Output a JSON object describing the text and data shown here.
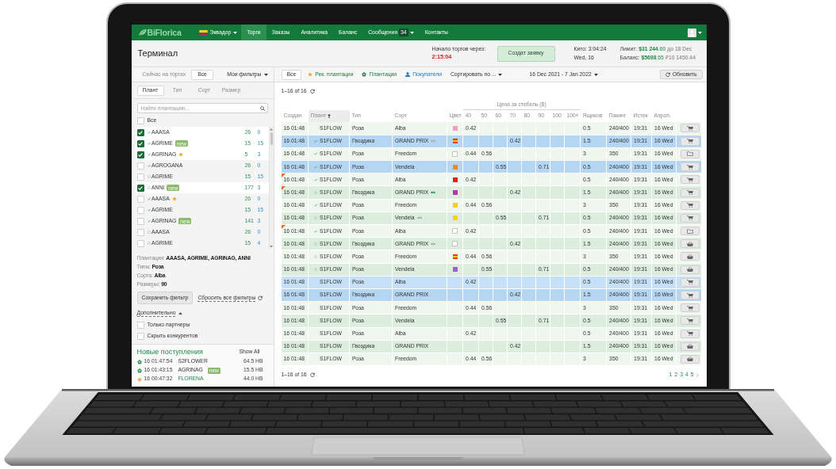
{
  "nav": {
    "logo": "BiFlorica",
    "country": "Эквадор",
    "items": [
      {
        "label": "Торги",
        "selected": true,
        "dropdown": false
      },
      {
        "label": "Заказы",
        "selected": false,
        "dropdown": false
      },
      {
        "label": "Аналитика",
        "selected": false,
        "dropdown": false
      },
      {
        "label": "Баланс",
        "selected": false,
        "dropdown": false
      },
      {
        "label": "Сообщения",
        "selected": false,
        "badge": "34",
        "dropdown": true
      },
      {
        "label": "Контакты",
        "selected": false,
        "dropdown": false
      }
    ]
  },
  "header": {
    "title": "Терминал",
    "countdown": {
      "label": "Начало торгов через:",
      "value": "2:15:04"
    },
    "create_button": "Создат заявку",
    "clock": [
      "Кито: 3:04:24",
      "Wed, 16"
    ],
    "limits": [
      {
        "label": "Лимит:",
        "value": "**$31 244**.60",
        "note": "до 18 Dec"
      },
      {
        "label": "Баланс:",
        "value": "**$5698**.65",
        "note": "₽10 1450.44"
      }
    ]
  },
  "filter_bar": {
    "on_sale_label": "Сейчас на торгах",
    "on_sale_button": "Все",
    "my_filters": "Мои фильтры",
    "all_button": "Все",
    "chips": [
      {
        "kind": "star",
        "label": "Рек. плантации"
      },
      {
        "kind": "flower",
        "label": "Плантации"
      },
      {
        "kind": "person",
        "label": "Покупатели"
      }
    ],
    "sort": "Сортировать по ...",
    "date_range": "16 Dec 2021 - 7 Jan 2022",
    "refresh_button": "Обновить"
  },
  "sidebar": {
    "tabs": [
      {
        "label": "Плант",
        "selected": true
      },
      {
        "label": "Тип",
        "selected": false
      },
      {
        "label": "Сорт",
        "selected": false
      },
      {
        "label": "Размер",
        "selected": false
      }
    ],
    "search": {
      "placeholder": "Найти плантацию..."
    },
    "select_all": {
      "label": "Все",
      "checked": false
    },
    "plantations": [
      {
        "name": "AAASA",
        "checked": true,
        "verified": true,
        "starred": false,
        "first_count": "26",
        "second_count": "0"
      },
      {
        "name": "AGRIME",
        "checked": true,
        "verified": true,
        "badge": "new",
        "starred": false,
        "first_count": "15",
        "second_count": "15"
      },
      {
        "name": "AGRINAG",
        "checked": true,
        "verified": true,
        "starred": true,
        "first_count": "5",
        "second_count": "3"
      },
      {
        "name": "AGROGANA",
        "checked": false,
        "verified": true,
        "starred": false,
        "first_count": "26",
        "second_count": "0"
      },
      {
        "name": "AGRIME",
        "checked": false,
        "verified": false,
        "starred": false,
        "first_count": "15",
        "second_count": "15"
      },
      {
        "name": "ANNI",
        "checked": true,
        "verified": false,
        "badge": "new",
        "starred": false,
        "first_count": "177",
        "second_count": "3"
      },
      {
        "name": "AAASA",
        "checked": false,
        "verified": true,
        "starred": true,
        "first_count": "26",
        "second_count": "0"
      },
      {
        "name": "AGRIME",
        "checked": false,
        "verified": true,
        "starred": false,
        "first_count": "15",
        "second_count": "15"
      },
      {
        "name": "AGRINAG",
        "checked": false,
        "verified": true,
        "badge": "new",
        "starred": false,
        "first_count": "141",
        "second_count": "3"
      },
      {
        "name": "AAASA",
        "checked": false,
        "verified": false,
        "starred": false,
        "first_count": "26",
        "second_count": "0"
      },
      {
        "name": "AGRIME",
        "checked": false,
        "verified": false,
        "starred": false,
        "first_count": "15",
        "second_count": "4"
      }
    ],
    "summary": [
      "Плантации: **AAASA, AGRIME, AGRINAG, ANNI**",
      "Типы: **Роза**",
      "Сорта: **Alba**",
      "Размеры: **90**"
    ],
    "save_button": "Сохранить фильтр",
    "reset_link": "Сбросить все фильтры",
    "more": {
      "label": "Дополнительно",
      "expanded": true,
      "options": [
        {
          "label": "Только партнеры",
          "checked": false
        },
        {
          "label": "Скрыть конкурентов",
          "checked": false
        }
      ]
    },
    "arrivals": {
      "title": "Новые поступления",
      "show_all": "Show All",
      "items": [
        {
          "time": "16 01:47:54",
          "name": "S2FLOWER",
          "starred": false,
          "size": "64.5 HB"
        },
        {
          "time": "16 01:43:15",
          "name": "AGRINAG",
          "badge": "new",
          "starred": false,
          "size": "15.5 HB"
        },
        {
          "time": "16 00:47:32",
          "name": "FLORENA",
          "starred": true,
          "size": "44.0 HB"
        }
      ]
    }
  },
  "table": {
    "count": "1–16 of 16",
    "price_group": "Цена за стебель ($)",
    "lead_columns": [
      {
        "label": "Создан",
        "sorted": false
      },
      {
        "label": "Плант",
        "sorted": true
      },
      {
        "label": "Тип",
        "sorted": false
      },
      {
        "label": "Сорт",
        "sorted": false
      },
      {
        "label": "Цвет",
        "sorted": false
      }
    ],
    "price_columns": [
      "40",
      "50",
      "60",
      "70",
      "80",
      "90",
      "100",
      "100+"
    ],
    "tail_columns": [
      "Ящиков",
      "Пакинг",
      "Истек",
      "Аэроп."
    ],
    "rows": [
      {
        "created": "16 01:48",
        "plant": "S1FLOW",
        "type": "Роза",
        "variety": "Alba",
        "color": "#ee9cc6",
        "prices": {
          "p1": "0.42"
        },
        "boxes": "0.5",
        "packing": "240/400",
        "expires": "19:31",
        "airport": "16 Wed",
        "action": {
          "kind": "cart"
        },
        "flagged": false,
        "selected": false
      },
      {
        "created": "16 01:48",
        "plant_status": {
          "kind": "check"
        },
        "plant": "S1FLOW",
        "type": "Гвоздика",
        "variety": "GRAND PRIX",
        "eye": {
          "color": "#a0a0a0"
        },
        "color": "#e23b2b",
        "stripe": {
          "color": "#f6c41c"
        },
        "prices": {
          "p4": "0.42"
        },
        "boxes": "1.5",
        "packing": "240/400",
        "expires": "19:31",
        "airport": "16 Wed",
        "action": {
          "kind": "cart"
        },
        "flagged": false,
        "selected": true
      },
      {
        "created": "16 01:48",
        "plant_status": {
          "kind": "check"
        },
        "plant": "S1FLOW",
        "type": "Роза",
        "variety": "Freedom",
        "color": "#ffffff",
        "prices": {
          "p1": "0.44",
          "p2": "0.56"
        },
        "boxes": "3",
        "packing": "350",
        "expires": "19:31",
        "airport": "16 Wed",
        "action": {
          "kind": "folder"
        },
        "flagged": false,
        "selected": false
      },
      {
        "created": "16 01:48",
        "plant_status": {
          "kind": "check"
        },
        "plant": "S1FLOW",
        "type": "Роза",
        "variety": "Vendela",
        "color": "#f0891c",
        "prices": {
          "p3": "0.55",
          "p6": "0.71"
        },
        "boxes": "0.5",
        "packing": "240/400",
        "expires": "19:31",
        "airport": "16 Wed",
        "action": {
          "kind": "cart"
        },
        "flagged": false,
        "selected": true
      },
      {
        "created": "16 01:48",
        "plant_status": {
          "kind": "check"
        },
        "plant": "S1FLOW",
        "type": "Роза",
        "variety": "Alba",
        "color": "#e22020",
        "prices": {
          "p1": "0.42"
        },
        "boxes": "0.5",
        "packing": "240/400",
        "expires": "19:31",
        "airport": "16 Wed",
        "action": {
          "kind": "cart"
        },
        "flagged": true,
        "selected": false
      },
      {
        "created": "16 01:48",
        "plant_status": {
          "kind": "circle"
        },
        "plant": "S1FLOW",
        "type": "Гвоздика",
        "variety": "GRAND PRIX",
        "eye": {
          "color": "#1f8a4c"
        },
        "color": "#b13a9e",
        "prices": {
          "p4": "0.42"
        },
        "boxes": "1.5",
        "packing": "240/400",
        "expires": "19:31",
        "airport": "16 Wed",
        "action": {
          "kind": "cart"
        },
        "flagged": true,
        "selected": false
      },
      {
        "created": "16 01:48",
        "plant_status": {
          "kind": "check"
        },
        "plant": "S1FLOW",
        "type": "Роза",
        "variety": "Freedom",
        "color": "#f5d20c",
        "prices": {
          "p1": "0.44",
          "p2": "0.56"
        },
        "boxes": "3",
        "packing": "350",
        "expires": "19:31",
        "airport": "16 Wed",
        "action": {
          "kind": "cart"
        },
        "flagged": false,
        "selected": false
      },
      {
        "created": "16 01:48",
        "plant_status": {
          "kind": "circle"
        },
        "plant": "S1FLOW",
        "type": "Роза",
        "variety": "Vendela",
        "eye": {
          "color": "#a0a0a0"
        },
        "color": "#f5d80c",
        "prices": {
          "p3": "0.55",
          "p6": "0.71"
        },
        "boxes": "0.5",
        "packing": "240/400",
        "expires": "19:31",
        "airport": "16 Wed",
        "action": {
          "kind": "cart"
        },
        "flagged": false,
        "selected": false
      },
      {
        "created": "16 01:48",
        "plant_status": {
          "kind": "check"
        },
        "plant": "S1FLOW",
        "type": "Роза",
        "variety": "Alba",
        "color": "#ffffff",
        "prices": {
          "p1": "0.42"
        },
        "boxes": "0.5",
        "packing": "240/400",
        "expires": "19:31",
        "airport": "16 Wed",
        "action": {
          "kind": "folder"
        },
        "flagged": true,
        "selected": false
      },
      {
        "created": "16 01:48",
        "plant_status": {
          "kind": "circle"
        },
        "plant": "S1FLOW",
        "type": "Гвоздика",
        "variety": "GRAND PRIX",
        "eye": {
          "color": "#a0a0a0"
        },
        "color": "#ffffff",
        "prices": {
          "p4": "0.42"
        },
        "boxes": "1.5",
        "packing": "240/400",
        "expires": "19:31",
        "airport": "16 Wed",
        "action": {
          "kind": "basket"
        },
        "flagged": false,
        "selected": false
      },
      {
        "created": "16 01:48",
        "plant_status": {
          "kind": "circle"
        },
        "plant": "S1FLOW",
        "type": "Роза",
        "variety": "Freedom",
        "color": "#e23b2b",
        "stripe": {
          "color": "#f6c41c"
        },
        "prices": {
          "p1": "0.44",
          "p2": "0.56"
        },
        "boxes": "3",
        "packing": "350",
        "expires": "19:31",
        "airport": "16 Wed",
        "action": {
          "kind": "basket"
        },
        "flagged": false,
        "selected": false
      },
      {
        "created": "16 01:48",
        "plant_status": {
          "kind": "circle"
        },
        "plant": "S1FLOW",
        "type": "Роза",
        "variety": "Vendela",
        "color": "#9b62c6",
        "prices": {
          "p2": "0.55",
          "p6": "0.71"
        },
        "boxes": "0.5",
        "packing": "240/400",
        "expires": "19:31",
        "airport": "16 Wed",
        "action": {
          "kind": "basket"
        },
        "flagged": false,
        "selected": false
      },
      {
        "created": "16 01:48",
        "plant": "S1FLOW",
        "type": "Роза",
        "variety": "Alba",
        "prices": {
          "p1": "0.42"
        },
        "boxes": "0.5",
        "packing": "240/400",
        "expires": "19:31",
        "airport": "16 Wed",
        "action": {
          "kind": "cart"
        },
        "flagged": false,
        "selected": true
      },
      {
        "created": "16 01:48",
        "plant": "S1FLOW",
        "type": "Гвоздика",
        "variety": "GRAND PRIX",
        "prices": {
          "p4": "0.42"
        },
        "boxes": "1.5",
        "packing": "240/400",
        "expires": "19:31",
        "airport": "16 Wed",
        "action": {
          "kind": "cart"
        },
        "flagged": false,
        "selected": true
      },
      {
        "created": "16 01:48",
        "plant": "S1FLOW",
        "type": "Роза",
        "variety": "Freedom",
        "prices": {
          "p1": "0.44",
          "p2": "0.56"
        },
        "boxes": "3",
        "packing": "350",
        "expires": "19:31",
        "airport": "16 Wed",
        "action": {
          "kind": "cart"
        },
        "flagged": false,
        "selected": false
      },
      {
        "created": "16 01:48",
        "plant": "S1FLOW",
        "type": "Роза",
        "variety": "Vendela",
        "prices": {
          "p3": "0.55",
          "p6": "0.71"
        },
        "boxes": "0.5",
        "packing": "240/400",
        "expires": "19:31",
        "airport": "16 Wed",
        "action": {
          "kind": "cart"
        },
        "flagged": false,
        "selected": false
      },
      {
        "created": "16 01:48",
        "plant": "S1FLOW",
        "type": "Роза",
        "variety": "Alba",
        "prices": {
          "p1": "0.42"
        },
        "boxes": "0.5",
        "packing": "240/400",
        "expires": "19:31",
        "airport": "16 Wed",
        "action": {
          "kind": "cart"
        },
        "flagged": false,
        "selected": false
      },
      {
        "created": "16 01:48",
        "plant": "S1FLOW",
        "type": "Гвоздика",
        "variety": "GRAND PRIX",
        "prices": {
          "p4": "0.42"
        },
        "boxes": "1.5",
        "packing": "240/400",
        "expires": "19:31",
        "airport": "16 Wed",
        "action": {
          "kind": "basket"
        },
        "flagged": false,
        "selected": false
      },
      {
        "created": "16 01:48",
        "plant": "S1FLOW",
        "type": "Роза",
        "variety": "Freedom",
        "prices": {
          "p1": "0.44",
          "p2": "0.56"
        },
        "boxes": "3",
        "packing": "350",
        "expires": "19:31",
        "airport": "16 Wed",
        "action": {
          "kind": "basket"
        },
        "flagged": false,
        "selected": false
      }
    ],
    "footer_count": "1–16 of 16",
    "pages": [
      "1",
      "2",
      "3",
      "4",
      "5"
    ]
  }
}
